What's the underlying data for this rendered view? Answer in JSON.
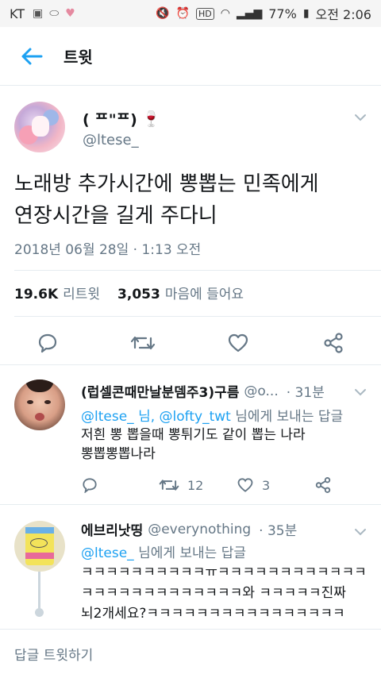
{
  "status_bar": {
    "carrier": "KT",
    "battery": "77%",
    "time": "오전 2:06",
    "icons": [
      "photo-icon",
      "pill-icon",
      "heart-icon",
      "mute-icon",
      "alarm-icon",
      "hd-icon",
      "wifi-icon",
      "signal-icon",
      "battery-icon"
    ]
  },
  "appbar": {
    "title": "트윗"
  },
  "tweet": {
    "display_name": "( ᄑ\"ᄑ)",
    "emoji": "🍷",
    "handle": "@ltese_",
    "text_line1": "노래방 추가시간에 뽕뽑는 민족에게",
    "text_line2": "연장시간을 길게 주다니",
    "date": "2018년 06월 28일 · 1:13 오전",
    "retweets_count": "19.6K",
    "retweets_label": "리트윗",
    "likes_count": "3,053",
    "likes_label": "마음에 들어요"
  },
  "replies": [
    {
      "name": "(럽셀콘때만날분뎀주3)구름",
      "handle": "@o...",
      "time": "· 31분",
      "to_mention1": "@ltese_ 님,",
      "to_mention2": "@lofty_twt",
      "to_suffix": "님에게 보내는 답글",
      "line1": "저흰 뽕 뽑을때 뽕튀기도 같이 뽑는 나라",
      "line2": "뽕뽑뽕뽑나라",
      "retweets": "12",
      "likes": "3"
    },
    {
      "name": "에브리낫띵",
      "handle": "@everynothing",
      "time": "· 35분",
      "to_mention1": "@ltese_",
      "to_suffix": "님에게 보내는 답글",
      "line1": "ㅋㅋㅋㅋㅋㅋㅋㅋㅋㅋㅠㅋㅋㅋㅋㅋㅋㅋㅋㅋㅋㅋㅋ",
      "line2": "ㅋㅋㅋㅋㅋㅋㅋㅋㅋㅋㅋㅋㅋ와 ㅋㅋㅋㅋㅋ진짜",
      "line3": "뇌2개세요?ㅋㅋㅋㅋㅋㅋㅋㅋㅋㅋㅋㅋㅋㅋㅋㅋ"
    }
  ],
  "compose": {
    "placeholder": "답글 트윗하기"
  },
  "colors": {
    "accent": "#1da1f2",
    "muted": "#657786",
    "divider": "#e6ecf0"
  }
}
